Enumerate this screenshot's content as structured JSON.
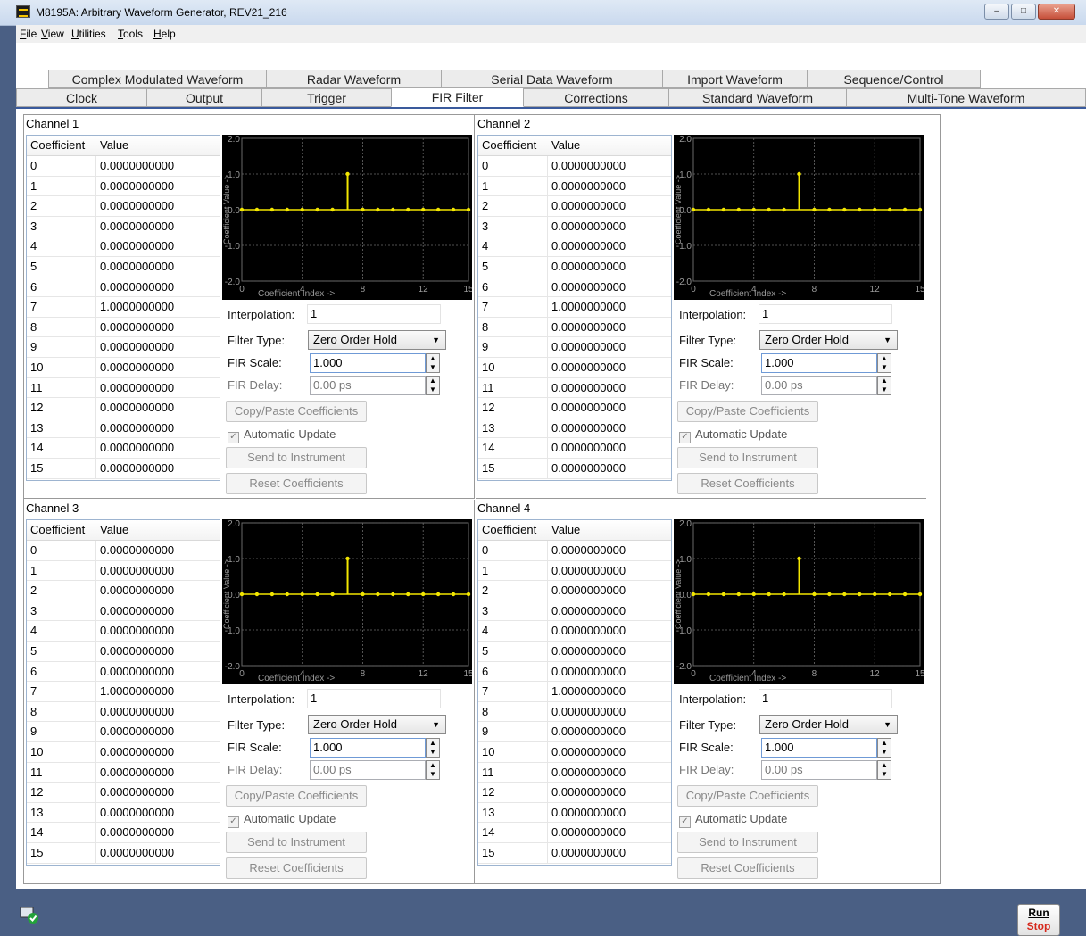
{
  "window": {
    "title": "M8195A: Arbitrary Waveform Generator, REV21_216",
    "buttons": {
      "minimize": "–",
      "maximize": "□",
      "close": "✕"
    }
  },
  "menu": [
    "File",
    "View",
    "Utilities",
    "Tools",
    "Help"
  ],
  "tabs_row1": [
    "Complex Modulated Waveform",
    "Radar Waveform",
    "Serial Data Waveform",
    "Import Waveform",
    "Sequence/Control"
  ],
  "tabs_row2": [
    "Clock",
    "Output",
    "Trigger",
    "FIR Filter",
    "Corrections",
    "Standard Waveform",
    "Multi-Tone Waveform"
  ],
  "active_tab": "FIR Filter",
  "table_headers": {
    "coefficient": "Coefficient",
    "value": "Value"
  },
  "channels": [
    {
      "title": "Channel 1",
      "coefficients": [
        {
          "idx": "0",
          "val": "0.0000000000"
        },
        {
          "idx": "1",
          "val": "0.0000000000"
        },
        {
          "idx": "2",
          "val": "0.0000000000"
        },
        {
          "idx": "3",
          "val": "0.0000000000"
        },
        {
          "idx": "4",
          "val": "0.0000000000"
        },
        {
          "idx": "5",
          "val": "0.0000000000"
        },
        {
          "idx": "6",
          "val": "0.0000000000"
        },
        {
          "idx": "7",
          "val": "1.0000000000"
        },
        {
          "idx": "8",
          "val": "0.0000000000"
        },
        {
          "idx": "9",
          "val": "0.0000000000"
        },
        {
          "idx": "10",
          "val": "0.0000000000"
        },
        {
          "idx": "11",
          "val": "0.0000000000"
        },
        {
          "idx": "12",
          "val": "0.0000000000"
        },
        {
          "idx": "13",
          "val": "0.0000000000"
        },
        {
          "idx": "14",
          "val": "0.0000000000"
        },
        {
          "idx": "15",
          "val": "0.0000000000"
        }
      ],
      "interpolation": "1",
      "filter_type": "Zero Order Hold",
      "fir_scale": "1.000",
      "fir_delay": "0.00 ps"
    },
    {
      "title": "Channel 2",
      "coefficients": [
        {
          "idx": "0",
          "val": "0.0000000000"
        },
        {
          "idx": "1",
          "val": "0.0000000000"
        },
        {
          "idx": "2",
          "val": "0.0000000000"
        },
        {
          "idx": "3",
          "val": "0.0000000000"
        },
        {
          "idx": "4",
          "val": "0.0000000000"
        },
        {
          "idx": "5",
          "val": "0.0000000000"
        },
        {
          "idx": "6",
          "val": "0.0000000000"
        },
        {
          "idx": "7",
          "val": "1.0000000000"
        },
        {
          "idx": "8",
          "val": "0.0000000000"
        },
        {
          "idx": "9",
          "val": "0.0000000000"
        },
        {
          "idx": "10",
          "val": "0.0000000000"
        },
        {
          "idx": "11",
          "val": "0.0000000000"
        },
        {
          "idx": "12",
          "val": "0.0000000000"
        },
        {
          "idx": "13",
          "val": "0.0000000000"
        },
        {
          "idx": "14",
          "val": "0.0000000000"
        },
        {
          "idx": "15",
          "val": "0.0000000000"
        }
      ],
      "interpolation": "1",
      "filter_type": "Zero Order Hold",
      "fir_scale": "1.000",
      "fir_delay": "0.00 ps"
    },
    {
      "title": "Channel 3",
      "coefficients": [
        {
          "idx": "0",
          "val": "0.0000000000"
        },
        {
          "idx": "1",
          "val": "0.0000000000"
        },
        {
          "idx": "2",
          "val": "0.0000000000"
        },
        {
          "idx": "3",
          "val": "0.0000000000"
        },
        {
          "idx": "4",
          "val": "0.0000000000"
        },
        {
          "idx": "5",
          "val": "0.0000000000"
        },
        {
          "idx": "6",
          "val": "0.0000000000"
        },
        {
          "idx": "7",
          "val": "1.0000000000"
        },
        {
          "idx": "8",
          "val": "0.0000000000"
        },
        {
          "idx": "9",
          "val": "0.0000000000"
        },
        {
          "idx": "10",
          "val": "0.0000000000"
        },
        {
          "idx": "11",
          "val": "0.0000000000"
        },
        {
          "idx": "12",
          "val": "0.0000000000"
        },
        {
          "idx": "13",
          "val": "0.0000000000"
        },
        {
          "idx": "14",
          "val": "0.0000000000"
        },
        {
          "idx": "15",
          "val": "0.0000000000"
        }
      ],
      "interpolation": "1",
      "filter_type": "Zero Order Hold",
      "fir_scale": "1.000",
      "fir_delay": "0.00 ps"
    },
    {
      "title": "Channel 4",
      "coefficients": [
        {
          "idx": "0",
          "val": "0.0000000000"
        },
        {
          "idx": "1",
          "val": "0.0000000000"
        },
        {
          "idx": "2",
          "val": "0.0000000000"
        },
        {
          "idx": "3",
          "val": "0.0000000000"
        },
        {
          "idx": "4",
          "val": "0.0000000000"
        },
        {
          "idx": "5",
          "val": "0.0000000000"
        },
        {
          "idx": "6",
          "val": "0.0000000000"
        },
        {
          "idx": "7",
          "val": "1.0000000000"
        },
        {
          "idx": "8",
          "val": "0.0000000000"
        },
        {
          "idx": "9",
          "val": "0.0000000000"
        },
        {
          "idx": "10",
          "val": "0.0000000000"
        },
        {
          "idx": "11",
          "val": "0.0000000000"
        },
        {
          "idx": "12",
          "val": "0.0000000000"
        },
        {
          "idx": "13",
          "val": "0.0000000000"
        },
        {
          "idx": "14",
          "val": "0.0000000000"
        },
        {
          "idx": "15",
          "val": "0.0000000000"
        }
      ],
      "interpolation": "1",
      "filter_type": "Zero Order Hold",
      "fir_scale": "1.000",
      "fir_delay": "0.00 ps"
    }
  ],
  "labels": {
    "interpolation": "Interpolation:",
    "filter_type": "Filter Type:",
    "fir_scale": "FIR Scale:",
    "fir_delay": "FIR Delay:",
    "copy_paste": "Copy/Paste Coefficients",
    "automatic_update": "Automatic Update",
    "send_to_instrument": "Send to Instrument",
    "reset_coefficients": "Reset Coefficients"
  },
  "chart_data": {
    "type": "scatter",
    "style": "stem",
    "xlabel": "Coefficient Index ->",
    "ylabel": "Coefficient Value ->",
    "xlim": [
      0,
      15
    ],
    "ylim": [
      -2.0,
      2.0
    ],
    "x_ticks": [
      "0",
      "4",
      "8",
      "12",
      "15"
    ],
    "y_ticks": [
      "2.0",
      "1.0",
      "0.0",
      "-1.0",
      "-2.0"
    ],
    "x": [
      0,
      1,
      2,
      3,
      4,
      5,
      6,
      7,
      8,
      9,
      10,
      11,
      12,
      13,
      14,
      15
    ],
    "y": [
      0,
      0,
      0,
      0,
      0,
      0,
      0,
      1,
      0,
      0,
      0,
      0,
      0,
      0,
      0,
      0
    ],
    "grid": true,
    "colors": {
      "background": "#000000",
      "stem": "#f2e600",
      "grid": "#6a6a6a",
      "text": "#9a9a9a"
    }
  },
  "run_stop": {
    "run": "Run",
    "stop": "Stop"
  }
}
